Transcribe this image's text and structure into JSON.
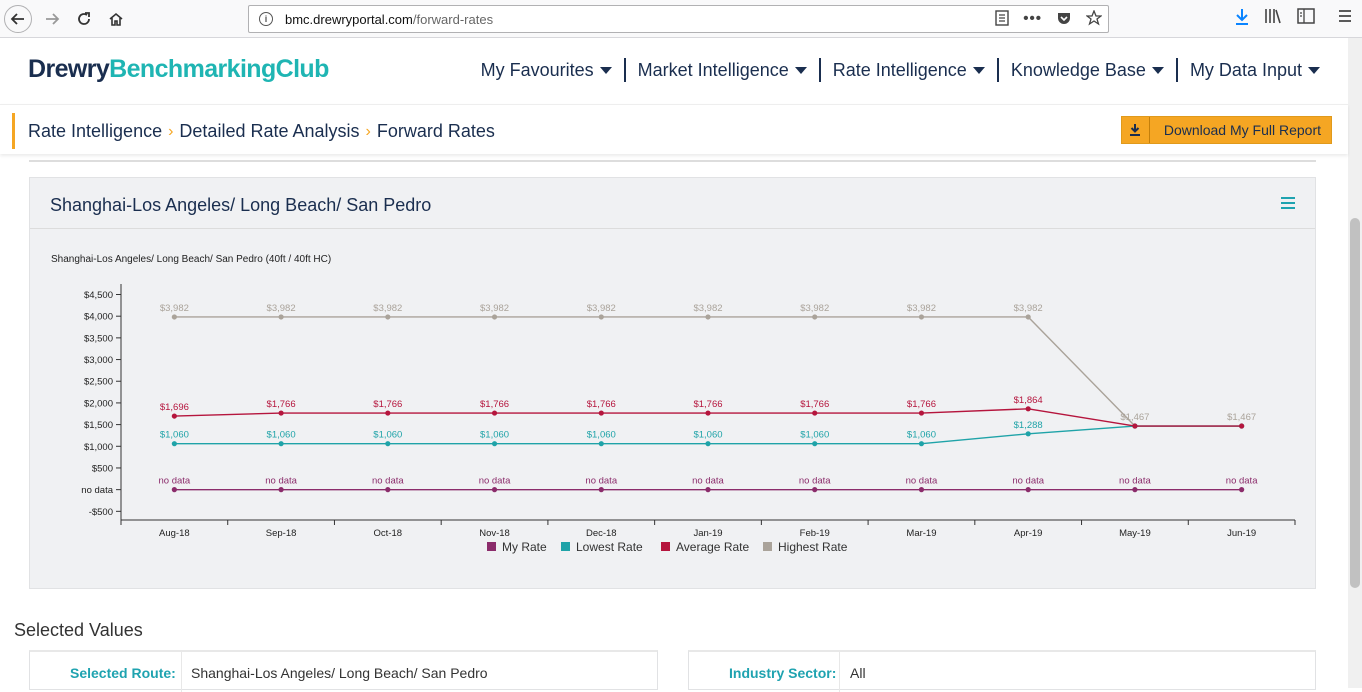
{
  "browser": {
    "url_host": "bmc.drewryportal.com",
    "url_path": "/forward-rates"
  },
  "site": {
    "logo_part1": "Drewry",
    "logo_part2": "BenchmarkingClub",
    "menu": [
      {
        "label": "My Favourites"
      },
      {
        "label": "Market Intelligence"
      },
      {
        "label": "Rate Intelligence"
      },
      {
        "label": "Knowledge Base"
      },
      {
        "label": "My Data Input"
      }
    ]
  },
  "breadcrumb": {
    "items": [
      "Rate Intelligence",
      "Detailed Rate Analysis",
      "Forward Rates"
    ],
    "sep": "›"
  },
  "download_button": {
    "label": "Download My Full Report"
  },
  "panel": {
    "title": "Shanghai-Los Angeles/ Long Beach/ San Pedro"
  },
  "chart_data": {
    "type": "line",
    "title": "Shanghai-Los Angeles/ Long Beach/ San Pedro (40ft / 40ft HC)",
    "categories": [
      "Aug-18",
      "Sep-18",
      "Oct-18",
      "Nov-18",
      "Dec-18",
      "Jan-19",
      "Feb-19",
      "Mar-19",
      "Apr-19",
      "May-19",
      "Jun-19"
    ],
    "y_ticks": [
      {
        "value": 4500,
        "label": "$4,500"
      },
      {
        "value": 4000,
        "label": "$4,000"
      },
      {
        "value": 3500,
        "label": "$3,500"
      },
      {
        "value": 3000,
        "label": "$3,000"
      },
      {
        "value": 2500,
        "label": "$2,500"
      },
      {
        "value": 2000,
        "label": "$2,000"
      },
      {
        "value": 1500,
        "label": "$1,500"
      },
      {
        "value": 1000,
        "label": "$1,000"
      },
      {
        "value": 500,
        "label": "$500"
      },
      {
        "value": 0,
        "label": "no data"
      },
      {
        "value": -500,
        "label": "-$500"
      }
    ],
    "ylim": [
      -700,
      4650
    ],
    "legend_position": "bottom",
    "series": [
      {
        "name": "My Rate",
        "color": "#8b2c6b",
        "values": [
          0,
          0,
          0,
          0,
          0,
          0,
          0,
          0,
          0,
          0,
          0
        ],
        "labels": [
          "no data",
          "no data",
          "no data",
          "no data",
          "no data",
          "no data",
          "no data",
          "no data",
          "no data",
          "no data",
          "no data"
        ]
      },
      {
        "name": "Lowest Rate",
        "color": "#1fa3a8",
        "values": [
          1060,
          1060,
          1060,
          1060,
          1060,
          1060,
          1060,
          1060,
          1288,
          1467,
          1467
        ],
        "labels": [
          "$1,060",
          "$1,060",
          "$1,060",
          "$1,060",
          "$1,060",
          "$1,060",
          "$1,060",
          "$1,060",
          "$1,288",
          "",
          ""
        ]
      },
      {
        "name": "Average Rate",
        "color": "#b5153d",
        "values": [
          1696,
          1766,
          1766,
          1766,
          1766,
          1766,
          1766,
          1766,
          1864,
          1467,
          1467
        ],
        "labels": [
          "$1,696",
          "$1,766",
          "$1,766",
          "$1,766",
          "$1,766",
          "$1,766",
          "$1,766",
          "$1,766",
          "$1,864",
          "",
          ""
        ]
      },
      {
        "name": "Highest Rate",
        "color": "#aaa39a",
        "values": [
          3982,
          3982,
          3982,
          3982,
          3982,
          3982,
          3982,
          3982,
          3982,
          1467,
          1467
        ],
        "labels": [
          "$3,982",
          "$3,982",
          "$3,982",
          "$3,982",
          "$3,982",
          "$3,982",
          "$3,982",
          "$3,982",
          "$3,982",
          "$1,467",
          "$1,467"
        ]
      }
    ]
  },
  "selected_values": {
    "heading": "Selected Values",
    "route_label": "Selected Route:",
    "route_value": "Shanghai-Los Angeles/ Long Beach/ San Pedro",
    "sector_label": "Industry Sector:",
    "sector_value": "All"
  }
}
